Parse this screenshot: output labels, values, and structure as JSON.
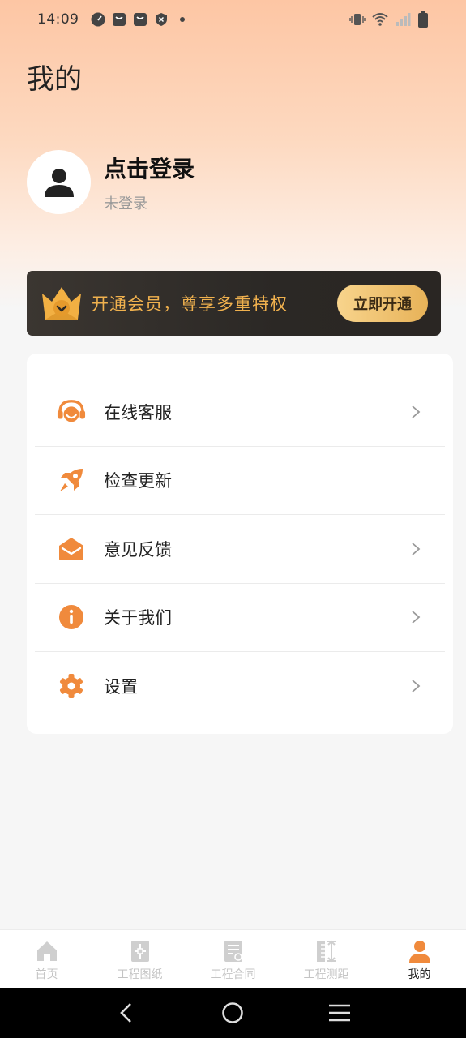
{
  "status_bar": {
    "time": "14:09",
    "left_icons": [
      "speedometer-icon",
      "bag-icon",
      "bag-icon",
      "shield-x-icon",
      "dot-icon"
    ],
    "right_icons": [
      "vibrate-icon",
      "wifi-icon",
      "signal-icon",
      "battery-icon"
    ]
  },
  "page": {
    "title": "我的"
  },
  "profile": {
    "avatar_icon": "user-icon",
    "login_title": "点击登录",
    "login_status": "未登录"
  },
  "vip": {
    "text": "开通会员，尊享多重特权",
    "button_label": "立即开通",
    "colors": {
      "text": "#f0b14e",
      "button_start": "#f8d48c",
      "button_end": "#e7b258"
    }
  },
  "menu": {
    "items": [
      {
        "label": "在线客服",
        "icon": "headset-icon",
        "has_chevron": true
      },
      {
        "label": "检查更新",
        "icon": "rocket-icon",
        "has_chevron": false
      },
      {
        "label": "意见反馈",
        "icon": "mail-icon",
        "has_chevron": true
      },
      {
        "label": "关于我们",
        "icon": "info-icon",
        "has_chevron": true
      },
      {
        "label": "设置",
        "icon": "gear-icon",
        "has_chevron": true
      }
    ],
    "accent_color": "#f08a3c"
  },
  "tab_bar": {
    "tabs": [
      {
        "label": "首页",
        "icon": "home-icon",
        "active": false
      },
      {
        "label": "工程图纸",
        "icon": "blueprint-icon",
        "active": false
      },
      {
        "label": "工程合同",
        "icon": "contract-icon",
        "active": false
      },
      {
        "label": "工程测距",
        "icon": "ruler-icon",
        "active": false
      },
      {
        "label": "我的",
        "icon": "user-icon",
        "active": true
      }
    ]
  },
  "nav_bar": {
    "buttons": [
      "back-icon",
      "home-circle-icon",
      "menu-icon"
    ]
  }
}
